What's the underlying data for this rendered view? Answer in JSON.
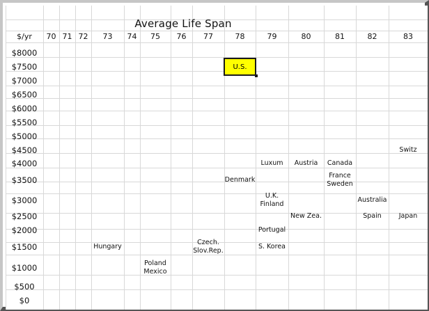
{
  "title": "Average Life Span",
  "y_header": "$/yr",
  "columns": [
    "70",
    "71",
    "72",
    "73",
    "74",
    "75",
    "76",
    "77",
    "78",
    "79",
    "80",
    "81",
    "82",
    "83"
  ],
  "rows": [
    "$8000",
    "$7500",
    "$7000",
    "$6500",
    "$6000",
    "$5500",
    "$5000",
    "$4500",
    "$4000",
    "$3500",
    "$3000",
    "$2500",
    "$2000",
    "$1500",
    "$1000",
    "$500",
    "$0"
  ],
  "entries": [
    {
      "col": 8,
      "row": 1,
      "text": "U.S.",
      "selected": true
    },
    {
      "col": 13,
      "row": 7,
      "text": "Switz"
    },
    {
      "col": 9,
      "row": 8,
      "text": "Luxum"
    },
    {
      "col": 10,
      "row": 8,
      "text": "Austria"
    },
    {
      "col": 11,
      "row": 8,
      "text": "Canada"
    },
    {
      "col": 8,
      "row": 9,
      "text": "Denmark"
    },
    {
      "col": 11,
      "row": 9,
      "text": "France\nSweden"
    },
    {
      "col": 9,
      "row": 10,
      "text": "U.K.\nFinland"
    },
    {
      "col": 12,
      "row": 10,
      "text": "Australia"
    },
    {
      "col": 10,
      "row": 11,
      "text": "New Zea."
    },
    {
      "col": 12,
      "row": 11,
      "text": "Spain"
    },
    {
      "col": 13,
      "row": 11,
      "text": "Japan"
    },
    {
      "col": 9,
      "row": 12,
      "text": "Portugal"
    },
    {
      "col": 3,
      "row": 13,
      "text": "Hungary"
    },
    {
      "col": 7,
      "row": 13,
      "text": "Czech.\nSlov.Rep."
    },
    {
      "col": 9,
      "row": 13,
      "text": "S. Korea"
    },
    {
      "col": 5,
      "row": 14,
      "text": "Poland\nMexico"
    }
  ],
  "colors": {
    "selected_fill": "#ffff00",
    "grid": "#d8d8d8"
  }
}
